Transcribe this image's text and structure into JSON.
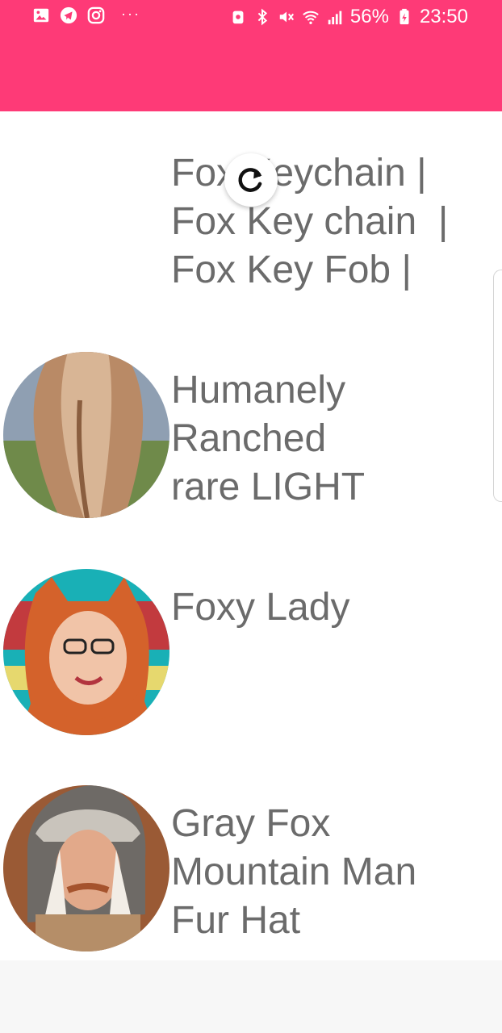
{
  "status_bar": {
    "battery": "56%",
    "time": "23:50",
    "left_icons": [
      "image-icon",
      "telegram-icon",
      "instagram-icon"
    ],
    "more": "···"
  },
  "colors": {
    "app_bar": "#fe3a77",
    "title_text": "#6b6b6b"
  },
  "items": [
    {
      "title": "Fox Keychain |\nFox Key chain  |\nFox Key Fob |"
    },
    {
      "title": "Humanely\nRanched\nrare LIGHT"
    },
    {
      "title": "Foxy Lady"
    },
    {
      "title": "Gray Fox\nMountain Man\nFur Hat"
    }
  ]
}
